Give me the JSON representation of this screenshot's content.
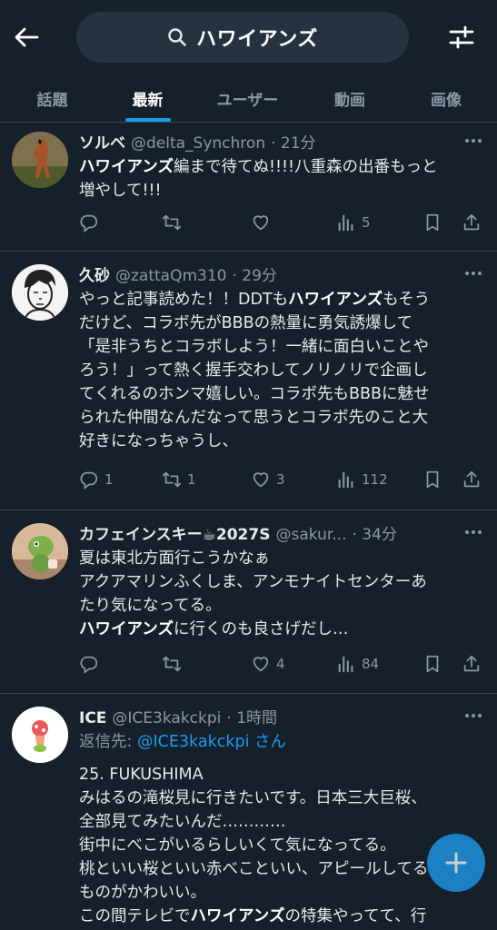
{
  "search": {
    "query": "ハワイアンズ"
  },
  "tabs": [
    {
      "label": "話題",
      "active": false
    },
    {
      "label": "最新",
      "active": true
    },
    {
      "label": "ユーザー",
      "active": false
    },
    {
      "label": "動画",
      "active": false
    },
    {
      "label": "画像",
      "active": false
    }
  ],
  "tweets": [
    {
      "name": "ソルベ",
      "handle": "@delta_Synchron",
      "time": "· 21分",
      "lines": [
        "<b>ハワイアンズ</b>編まで待てぬ!!!!八重森の出番もっと",
        "増やして!!!"
      ],
      "replies": "",
      "retweets": "",
      "likes": "",
      "views": "5"
    },
    {
      "name": "久砂",
      "handle": "@zattaQm310",
      "time": "· 29分",
      "lines": [
        "やっと記事読めた！！DDTも<b>ハワイアンズ</b>もそう",
        "だけど、コラボ先がBBBの熱量に勇気誘爆して",
        "「是非うちとコラボしよう！一緒に面白いことや",
        "ろう！」って熱く握手交わしてノリノリで企画し",
        "てくれるのホンマ嬉しい。コラボ先もBBBに魅せ",
        "られた仲間なんだなって思うとコラボ先のこと大",
        "好きになっちゃうし、"
      ],
      "replies": "1",
      "retweets": "1",
      "likes": "3",
      "views": "112"
    },
    {
      "name": "カフェインスキー☕2027S",
      "handle": "@sakur...",
      "time": "· 34分",
      "lines": [
        "夏は東北方面行こうかなぁ",
        "アクアマリンふくしま、アンモナイトセンターあ",
        "たり気になってる。",
        "<b>ハワイアンズ</b>に行くのも良さげだし…"
      ],
      "replies": "",
      "retweets": "",
      "likes": "4",
      "views": "84"
    },
    {
      "name": "ICE",
      "handle": "@ICE3kakckpi",
      "time": "· 1時間",
      "reply_to_label": "返信先: ",
      "reply_to_handle": "@ICE3kakckpi さん",
      "lines": [
        "25. FUKUSHIMA",
        "みはるの滝桜見に行きたいです。日本三大巨桜、",
        "全部見てみたいんだ…………",
        "街中にべこがいるらしいくて気になってる。",
        "桃といい桜といい赤べこといい、アピールしてる",
        "ものがかわいい。",
        "この間テレビで<b>ハワイアンズ</b>の特集やってて、行"
      ]
    }
  ],
  "colors": {
    "background": "#15202b",
    "accent": "#1d9bf0",
    "muted": "#8b98a5",
    "divider": "#38444d"
  },
  "icons": [
    "arrow-left-icon",
    "search-icon",
    "filter-icon",
    "more-icon",
    "reply-icon",
    "retweet-icon",
    "like-icon",
    "views-icon",
    "bookmark-icon",
    "share-icon",
    "compose-icon"
  ]
}
